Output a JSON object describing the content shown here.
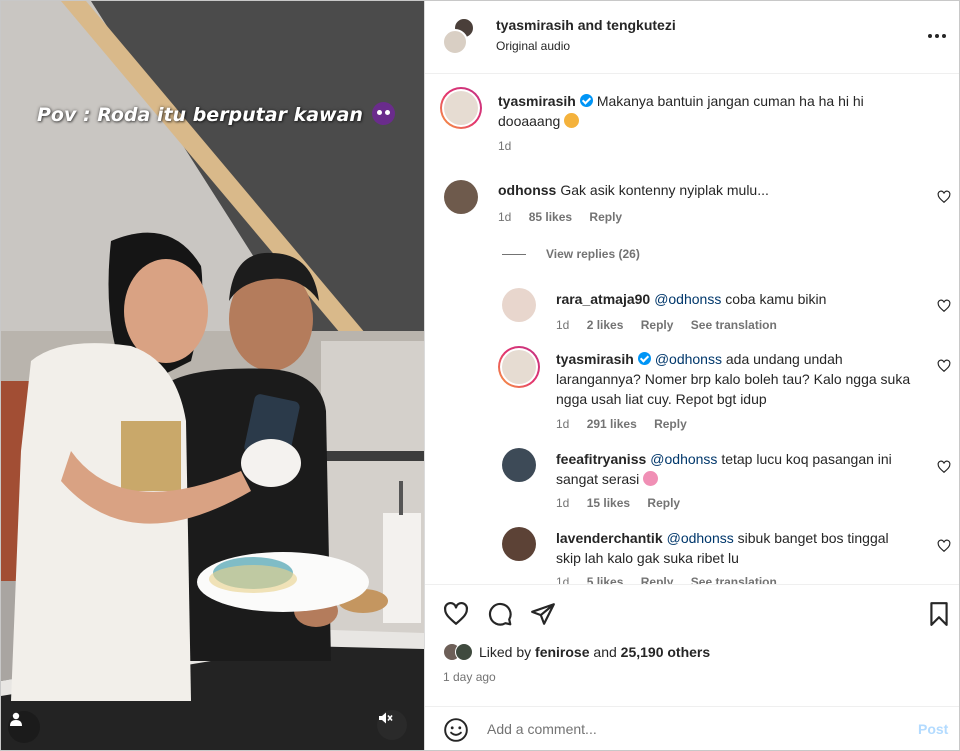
{
  "media": {
    "overlay_caption": "Pov : Roda itu berputar kawan",
    "overlay_emoji": "smiling-devil-emoji"
  },
  "header": {
    "usernames": "tyasmirasih and tengkutezi",
    "audio": "Original audio"
  },
  "caption": {
    "username": "tyasmirasih",
    "text": "Makanya bantuin jangan cuman ha ha hi hi dooaaang",
    "emoji": "smiling-face-with-hearts",
    "time": "1d"
  },
  "comments": [
    {
      "username": "odhonss",
      "text": "Gak asik kontenny nyiplak mulu...",
      "time": "1d",
      "likes": "85 likes",
      "reply": "Reply"
    }
  ],
  "view_replies": "View replies (26)",
  "replies": [
    {
      "username": "rara_atmaja90",
      "mention": "@odhonss",
      "text": "coba kamu bikin",
      "time": "1d",
      "likes": "2 likes",
      "reply": "Reply",
      "translate": "See translation"
    },
    {
      "username": "tyasmirasih",
      "mention": "@odhonss",
      "text": "ada undang undah larangannya? Nomer brp kalo boleh tau? Kalo ngga suka ngga usah liat cuy. Repot bgt idup",
      "time": "1d",
      "likes": "291 likes",
      "reply": "Reply"
    },
    {
      "username": "feeafitryaniss",
      "mention": "@odhonss",
      "text": "tetap lucu koq pasangan ini sangat serasi",
      "time": "1d",
      "likes": "15 likes",
      "reply": "Reply"
    },
    {
      "username": "lavenderchantik",
      "mention": "@odhonss",
      "text": "sibuk banget bos tinggal skip lah kalo gak suka ribet lu",
      "time": "1d",
      "likes": "5 likes",
      "reply": "Reply",
      "translate": "See translation"
    }
  ],
  "likes": {
    "prefix": "Liked by",
    "user": "fenirose",
    "and": "and",
    "others": "25,190 others"
  },
  "date": "1 day ago",
  "add_comment": {
    "placeholder": "Add a comment...",
    "post": "Post"
  },
  "colors": {
    "link": "#00376b",
    "verified": "#0095f6",
    "post_disabled": "#b3dbff",
    "secondary_text": "#737373"
  }
}
